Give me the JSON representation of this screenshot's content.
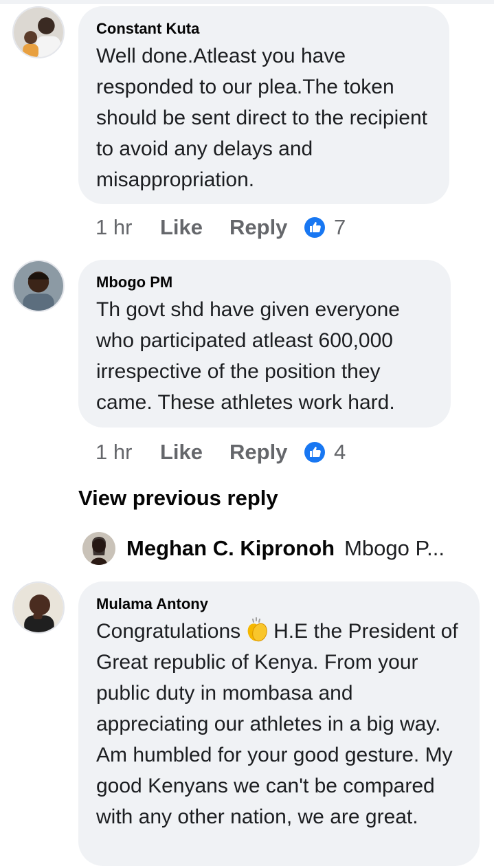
{
  "comments": [
    {
      "author": "Constant Kuta",
      "text": "Well done.Atleast you have responded to our plea.The token should be sent direct to the recipient to avoid any delays and misappropriation.",
      "time": "1 hr",
      "like_label": "Like",
      "reply_label": "Reply",
      "reactions": "7"
    },
    {
      "author": "Mbogo PM",
      "text": "Th govt shd have given everyone who participated atleast 600,000 irrespective of the position they came. These athletes work hard.",
      "time": "1 hr",
      "like_label": "Like",
      "reply_label": "Reply",
      "reactions": "4"
    },
    {
      "author": "Mulama Antony",
      "text_before_emoji": "Congratulations",
      "emoji": "clapping-hands",
      "text_after_emoji": "H.E the President of Great republic of Kenya. From your public duty in mombasa and appreciating our athletes in a big way. Am humbled for your good gesture. My good Kenyans we can't be compared with any other nation, we are great."
    }
  ],
  "view_previous": "View previous reply",
  "reply_preview": {
    "author": "Meghan C. Kipronoh",
    "text": "Mbogo P..."
  },
  "colors": {
    "bubble": "#f0f2f5",
    "meta_text": "#65676b",
    "like_blue": "#1877f2"
  }
}
